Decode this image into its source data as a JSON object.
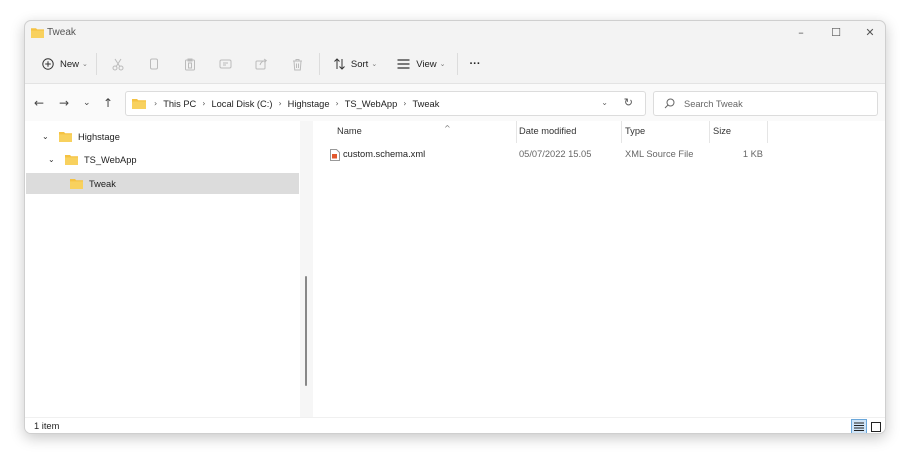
{
  "window": {
    "title": "Tweak",
    "minimize_glyph": "–",
    "maximize_glyph": "☐",
    "close_glyph": "✕"
  },
  "toolbar": {
    "new_label": "New",
    "sort_label": "Sort",
    "view_label": "View",
    "more_glyph": "···",
    "caret_glyph": "⌄"
  },
  "nav": {
    "back_glyph": "←",
    "forward_glyph": "→",
    "recent_glyph": "⌄",
    "up_glyph": "↑"
  },
  "address": {
    "crumbs": [
      "This PC",
      "Local Disk (C:)",
      "Highstage",
      "TS_WebApp",
      "Tweak"
    ],
    "separator": "›",
    "dropdown_glyph": "⌄",
    "refresh_glyph": "↻"
  },
  "search": {
    "placeholder": "Search Tweak"
  },
  "tree": {
    "items": [
      {
        "label": "Highstage",
        "chevron": "⌄"
      },
      {
        "label": "TS_WebApp",
        "chevron": "⌄"
      },
      {
        "label": "Tweak",
        "chevron": ""
      }
    ]
  },
  "columns": {
    "name": "Name",
    "date_modified": "Date modified",
    "type": "Type",
    "size": "Size",
    "sort_glyph": "^"
  },
  "files": [
    {
      "name": "custom.schema.xml",
      "date_modified": "05/07/2022 15.05",
      "type": "XML Source File",
      "size": "1 KB"
    }
  ],
  "status": {
    "item_count": "1 item"
  },
  "colors": {
    "folder": "#f5c242",
    "accent": "#0067c0",
    "selected": "#dcdcdc"
  }
}
